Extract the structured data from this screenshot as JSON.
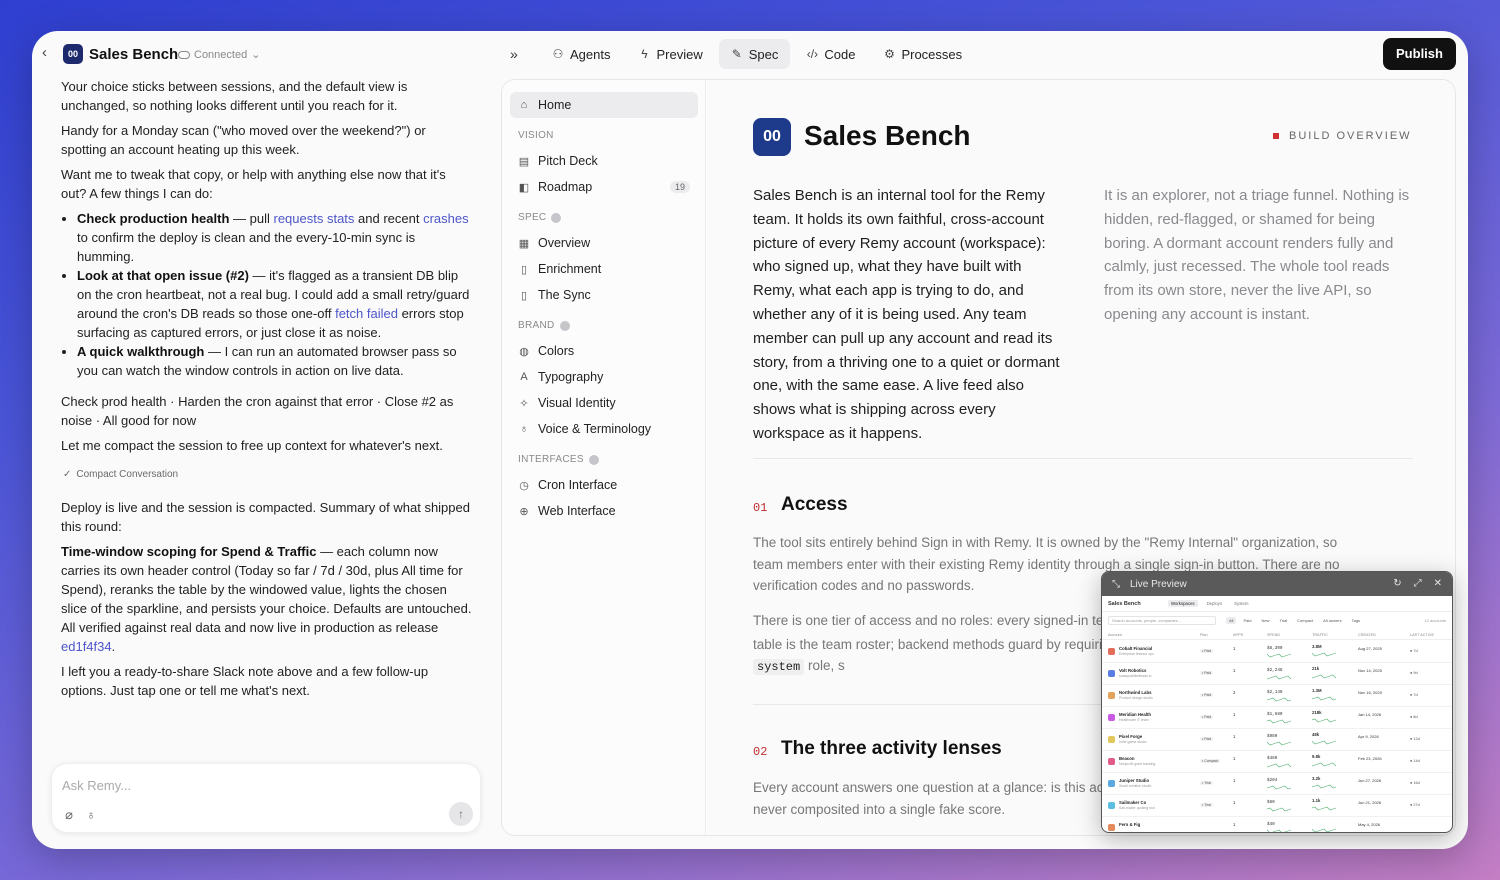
{
  "header": {
    "app_name": "Sales Bench",
    "status": "Connected",
    "tabs": [
      {
        "label": "Agents",
        "icon": "agents-icon"
      },
      {
        "label": "Preview",
        "icon": "bolt-icon"
      },
      {
        "label": "Spec",
        "icon": "edit-icon",
        "active": true
      },
      {
        "label": "Code",
        "icon": "code-icon"
      },
      {
        "label": "Processes",
        "icon": "processes-icon"
      }
    ],
    "publish_label": "Publish"
  },
  "chat": {
    "p1": "Your choice sticks between sessions, and the default view is unchanged, so nothing looks different until you reach for it.",
    "p2": "Handy for a Monday scan (\"who moved over the weekend?\") or spotting an account heating up this week.",
    "p3": "Want me to tweak that copy, or help with anything else now that it's out? A few things I can do:",
    "b1_bold": "Check production health",
    "b1_a": " — pull ",
    "b1_link1": "requests stats",
    "b1_b": " and recent ",
    "b1_link2": "crashes",
    "b1_c": " to confirm the deploy is clean and the every-10-min sync is humming.",
    "b2_bold": "Look at that open issue (#2)",
    "b2_a": " — it's flagged as a transient DB blip on the cron heartbeat, not a real bug. I could add a small retry/guard around the cron's DB reads so those one-off ",
    "b2_link": "fetch failed",
    "b2_b": " errors stop surfacing as captured errors, or just close it as noise.",
    "b3_bold": "A quick walkthrough",
    "b3_a": " — I can run an automated browser pass so you can watch the window controls in action on live data.",
    "p4": "Check prod health · Harden the cron against that error · Close #2 as noise · All good for now",
    "p5": "Let me compact the session to free up context for whatever's next.",
    "compact_label": "Compact Conversation",
    "p6": "Deploy is live and the session is compacted. Summary of what shipped this round:",
    "p7_bold": "Time-window scoping for Spend & Traffic",
    "p7_a": " — each column now carries its own header control (Today so far / 7d / 30d, plus All time for Spend), reranks the table by the windowed value, lights the chosen slice of the sparkline, and persists your choice. Defaults are untouched. All verified against real data and now live in production as release ",
    "p7_link": "ed1f4f34",
    "p7_b": ".",
    "p8": "I left you a ready-to-share Slack note above and a few follow-up options. Just tap one or tell me what's next.",
    "input_placeholder": "Ask Remy..."
  },
  "sidebar": {
    "home": "Home",
    "vision_label": "VISION",
    "vision": [
      {
        "label": "Pitch Deck",
        "icon": "slides-icon"
      },
      {
        "label": "Roadmap",
        "icon": "roadmap-icon",
        "badge": "19"
      }
    ],
    "spec_label": "SPEC",
    "spec": [
      {
        "label": "Overview",
        "icon": "doc-icon"
      },
      {
        "label": "Enrichment",
        "icon": "file-icon"
      },
      {
        "label": "The Sync",
        "icon": "file-icon"
      }
    ],
    "brand_label": "BRAND",
    "brand": [
      {
        "label": "Colors",
        "icon": "palette-icon"
      },
      {
        "label": "Typography",
        "icon": "type-icon"
      },
      {
        "label": "Visual Identity",
        "icon": "sparkle-icon"
      },
      {
        "label": "Voice & Terminology",
        "icon": "mic-icon"
      }
    ],
    "interfaces_label": "INTERFACES",
    "interfaces": [
      {
        "label": "Cron Interface",
        "icon": "clock-icon"
      },
      {
        "label": "Web Interface",
        "icon": "globe-icon"
      }
    ]
  },
  "doc": {
    "title": "Sales Bench",
    "logo_text": "00",
    "eyebrow": "BUILD OVERVIEW",
    "lede_left": "Sales Bench is an internal tool for the Remy team. It holds its own faithful, cross-account picture of every Remy account (workspace): who signed up, what they have built with Remy, what each app is trying to do, and whether any of it is being used. Any team member can pull up any account and read its story, from a thriving one to a quiet or dormant one, with the same ease. A live feed also shows what is shipping across every workspace as it happens.",
    "lede_right": "It is an explorer, not a triage funnel. Nothing is hidden, red-flagged, or shamed for being boring. A dormant account renders fully and calmly, just recessed. The whole tool reads from its own store, never the live API, so opening any account is instant.",
    "s1_num": "01",
    "s1_title": "Access",
    "s1_p1": "The tool sits entirely behind Sign in with Remy. It is owned by the \"Remy Internal\" organization, so team members enter with their existing Remy identity through a single sign-in button. There are no verification codes and no passwords.",
    "s1_p2_a": "There is one tier of access and no roles: every signed-in team member sees everything. The ",
    "s1_p2_code1": "users",
    "s1_p2_b": " table is the team roster; backend methods guard by requiring a signed-in user (or the platform ",
    "s1_p2_code2": "system",
    "s1_p2_c": " role, s",
    "s2_num": "02",
    "s2_title": "The three activity lenses",
    "s2_p1": "Every account answers one question at a glance: is this account alive? The distinct signals are never composited into a single fake score."
  },
  "preview": {
    "title": "Live Preview",
    "brand": "Sales Bench",
    "tabs": [
      "Workspaces",
      "Deploys",
      "System"
    ],
    "search_placeholder": "Search accounts, people, companies…",
    "filters": [
      "All",
      "Paid",
      "New",
      "Trial",
      "Compact"
    ],
    "owner_filter": "All owners",
    "tags_filter": "Tags",
    "count": "12 accounts",
    "columns": [
      "Account",
      "Plan",
      "APPS",
      "SPEND",
      "TRAFFIC",
      "CREATED",
      "LAST ACTIVE"
    ],
    "rows": [
      {
        "name": "Cobalt Financial",
        "sub": "Enterprise finance ops",
        "plan": "Paid",
        "apps": "1",
        "spend": "$8,300",
        "traffic": "3.8M",
        "created": "Aug 27, 2025",
        "last": "7d",
        "color": "#e26d5c"
      },
      {
        "name": "Volt Robotics",
        "sub": "saasqualifiedleads.io",
        "plan": "Paid",
        "apps": "1",
        "spend": "$2,248",
        "traffic": "21k",
        "created": "Nov 14, 2025",
        "last": "9d",
        "color": "#5c7ee2"
      },
      {
        "name": "Northwind Labs",
        "sub": "Product design studio",
        "plan": "Paid",
        "apps": "2",
        "spend": "$2,140",
        "traffic": "1.3M",
        "created": "Nov 16, 2025",
        "last": "7d",
        "color": "#e2a35c"
      },
      {
        "name": "Meridian Health",
        "sub": "Healthcare IT team",
        "plan": "Paid",
        "apps": "1",
        "spend": "$1,680",
        "traffic": "218k",
        "created": "Jan 14, 2026",
        "last": "8d",
        "color": "#c95ce2"
      },
      {
        "name": "Pixel Forge",
        "sub": "Indie game studio",
        "plan": "Paid",
        "apps": "1",
        "spend": "$980",
        "traffic": "48k",
        "created": "Apr 9, 2026",
        "last": "12d",
        "color": "#e2c85c"
      },
      {
        "name": "Beacon",
        "sub": "Nonprofit grant tracking",
        "plan": "Compact",
        "apps": "1",
        "spend": "$480",
        "traffic": "9.8k",
        "created": "Feb 23, 2026",
        "last": "14d",
        "color": "#e25c8a"
      },
      {
        "name": "Juniper Studio",
        "sub": "Small creative studio",
        "plan": "Trial",
        "apps": "1",
        "spend": "$204",
        "traffic": "3.2k",
        "created": "Jun 27, 2026",
        "last": "16d",
        "color": "#5ca8e2"
      },
      {
        "name": "Sailmaker Co",
        "sub": "Sail-maker quoting tool",
        "plan": "Trial",
        "apps": "1",
        "spend": "$60",
        "traffic": "1.1k",
        "created": "Jun 21, 2026",
        "last": "27d",
        "color": "#5cbde2"
      },
      {
        "name": "Fern & Fig",
        "sub": "",
        "plan": "",
        "apps": "1",
        "spend": "$40",
        "traffic": "",
        "created": "May 4, 2026",
        "last": "",
        "color": "#e28a5c"
      }
    ]
  }
}
